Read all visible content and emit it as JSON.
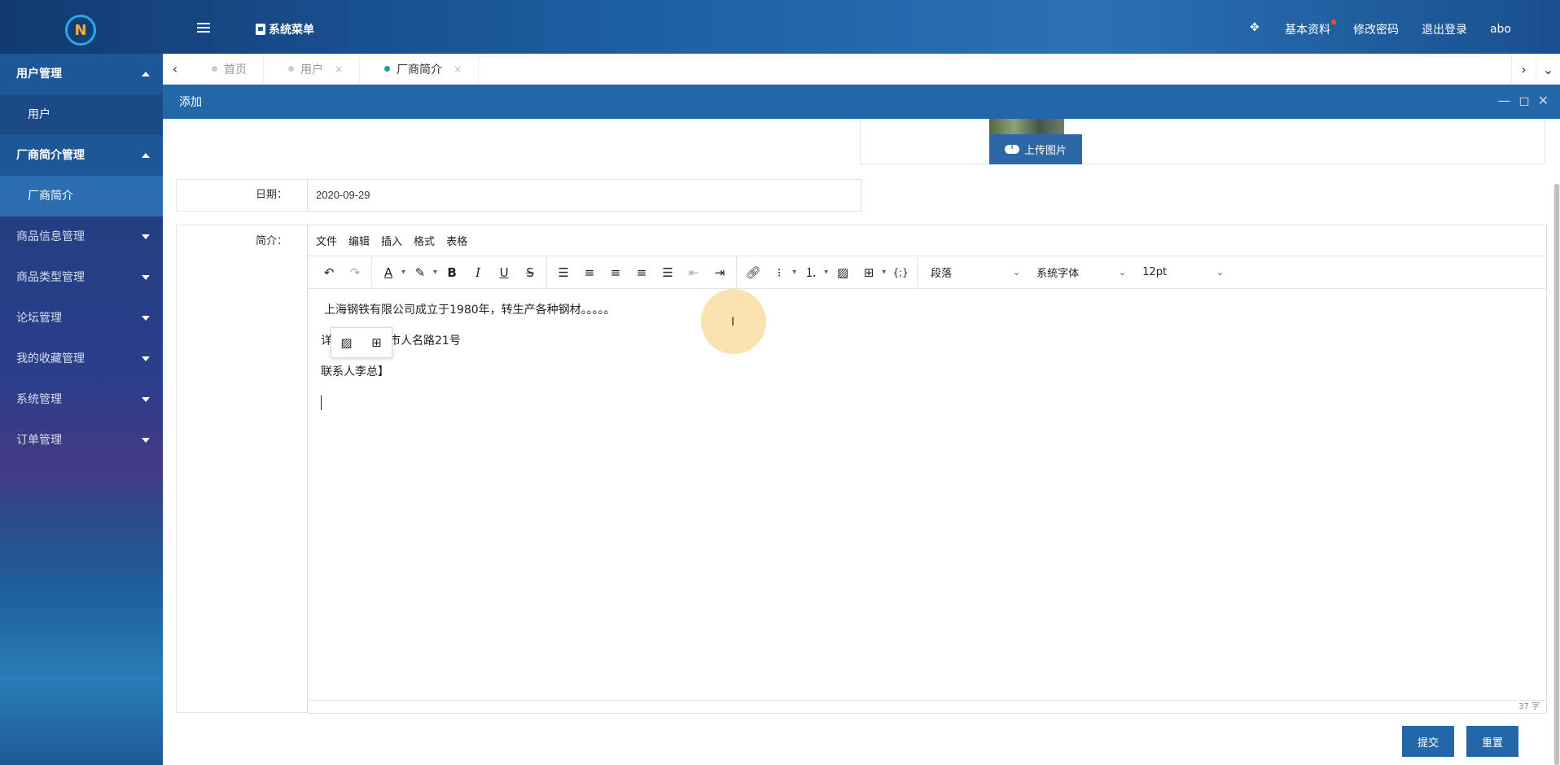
{
  "header": {
    "menu_title": "系统菜单",
    "links": {
      "profile": "基本资料",
      "change_password": "修改密码",
      "logout": "退出登录",
      "user": "abo"
    },
    "profile_dot_color": "#ff4a2a"
  },
  "sidebar": {
    "user_mgmt": "用户管理",
    "user": "用户",
    "vendor_mgmt": "厂商简介管理",
    "vendor_intro": "厂商简介",
    "product_info": "商品信息管理",
    "product_type": "商品类型管理",
    "forum": "论坛管理",
    "favorites": "我的收藏管理",
    "system": "系统管理",
    "orders": "订单管理"
  },
  "tabs": {
    "home": "首页",
    "user": "用户",
    "vendor": "厂商简介",
    "close_glyph": "×"
  },
  "dialog": {
    "title": "添加"
  },
  "form": {
    "upload_label": "上传图片",
    "date_label": "日期：",
    "date_value": "2020-09-29",
    "intro_label": "简介：",
    "submit": "提交",
    "reset": "重置"
  },
  "editor": {
    "menus": {
      "file": "文件",
      "edit": "编辑",
      "insert": "插入",
      "format": "格式",
      "table": "表格"
    },
    "block_format": "段落",
    "font_family": "系统字体",
    "font_size": "12pt",
    "lines": {
      "line1": "上海钢铁有限公司成立于1980年，转生产各种钢材。。。。。",
      "line2": "详细地址上海市人名路21号",
      "line3": "联系人李总】"
    },
    "word_count": "37 字"
  },
  "colors": {
    "primary": "#2467a9",
    "active_tab_dot": "#1ea098"
  }
}
